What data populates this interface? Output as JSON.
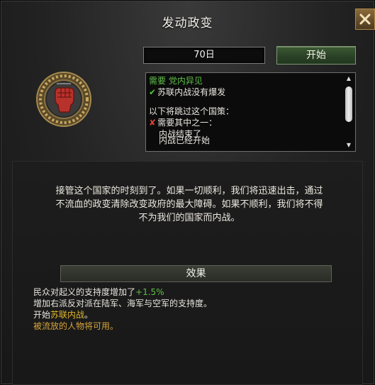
{
  "window": {
    "title": "发动政变"
  },
  "focus": {
    "duration": "70日",
    "start_label": "开始",
    "icon": "raised-fist-icon"
  },
  "requirements": {
    "req_header": "需要 党内异见",
    "req_met": "苏联内战没有爆发",
    "bypass_header": "以下将跳过这个国策：",
    "bypass_any": "需要其中之一：",
    "bypass_item1": "内战结束了",
    "bypass_item2": "内战已经开始"
  },
  "description": {
    "line1": "接管这个国家的时刻到了。如果一切顺利，我们将迅速出击，通过",
    "line2": "不流血的政变清除改变政府的最大障碍。如果不顺利，我们将不得",
    "line3": "不为我们的国家而内战。"
  },
  "effects": {
    "header": "效果",
    "line1_text": "民众对起义的支持度增加了",
    "line1_value": "+1.5%",
    "line2": "增加右派反对派在陆军、海军与空军的支持度。",
    "line3_prefix": "开始",
    "line3_link": "苏联内战",
    "line3_suffix": "。",
    "line4": "被流放的人物将可用。"
  },
  "colors": {
    "positive": "#5fbf49",
    "highlight": "#e1b729",
    "start_button": "#2b4226"
  }
}
